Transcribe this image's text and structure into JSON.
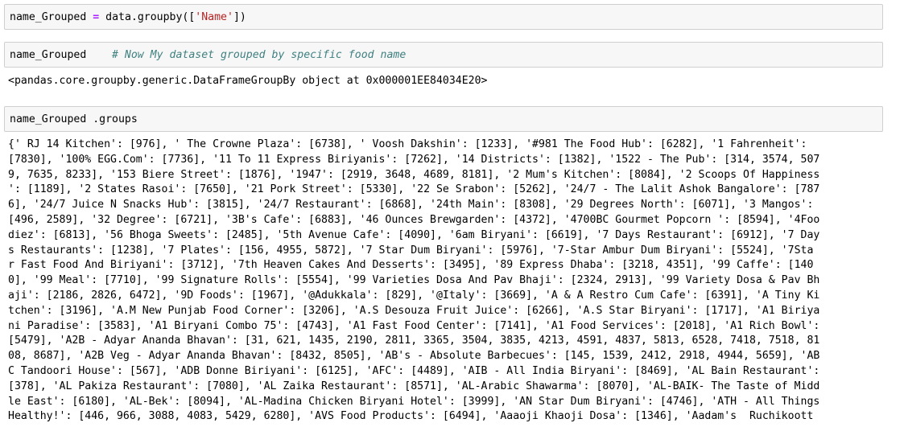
{
  "cells": [
    {
      "code": {
        "var": "name_Grouped",
        "op": "=",
        "rest_pre": "data.groupby([",
        "str": "'Name'",
        "rest_post": "])"
      }
    },
    {
      "code": {
        "var": "name_Grouped",
        "comment": "# Now My dataset grouped by specific food name"
      },
      "output": "<pandas.core.groupby.generic.DataFrameGroupBy object at 0x000001EE84034E20>"
    },
    {
      "code": {
        "var": "name_Grouped .groups"
      },
      "output_lines": [
        "{' RJ 14 Kitchen': [976], ' The Crowne Plaza': [6738], ' Voosh Dakshin': [1233], '#981 The Food Hub': [6282], '1 Fahrenheit':",
        "[7830], '100% EGG.Com': [7736], '11 To 11 Express Biriyanis': [7262], '14 Districts': [1382], '1522 - The Pub': [314, 3574, 507",
        "9, 7635, 8233], '153 Biere Street': [1876], '1947': [2919, 3648, 4689, 8181], '2 Mum's Kitchen': [8084], '2 Scoops Of Happiness",
        "': [1189], '2 States Rasoi': [7650], '21 Pork Street': [5330], '22 Se Srabon': [5262], '24/7 - The Lalit Ashok Bangalore': [787",
        "6], '24/7 Juice N Snacks Hub': [3815], '24/7 Restaurant': [6868], '24th Main': [8308], '29 Degrees North': [6071], '3 Mangos':",
        "[496, 2589], '32 Degree': [6721], '3B's Cafe': [6883], '46 Ounces Brewgarden': [4372], '4700BC Gourmet Popcorn ': [8594], '4Foo",
        "diez': [6813], '56 Bhoga Sweets': [2485], '5th Avenue Cafe': [4090], '6am Biryani': [6619], '7 Days Restaurant': [6912], '7 Day",
        "s Restaurants': [1238], '7 Plates': [156, 4955, 5872], '7 Star Dum Biryani': [5976], '7-Star Ambur Dum Biryani': [5524], '7Sta",
        "r Fast Food And Biriyani': [3712], '7th Heaven Cakes And Desserts': [3495], '89 Express Dhaba': [3218, 4351], '99 Caffe': [140",
        "0], '99 Meal': [7710], '99 Signature Rolls': [5554], '99 Varieties Dosa And Pav Bhaji': [2324, 2913], '99 Variety Dosa & Pav Bh",
        "aji': [2186, 2826, 6472], '9D Foods': [1967], '@Adukkala': [829], '@Italy': [3669], 'A & A Restro Cum Cafe': [6391], 'A Tiny Ki",
        "tchen': [3196], 'A.M New Punjab Food Corner': [3206], 'A.S Desouza Fruit Juice': [6266], 'A.S Star Biryani': [1717], 'A1 Biriya",
        "ni Paradise': [3583], 'A1 Biryani Combo 75': [4743], 'A1 Fast Food Center': [7141], 'A1 Food Services': [2018], 'A1 Rich Bowl':",
        "[5479], 'A2B - Adyar Ananda Bhavan': [31, 621, 1435, 2190, 2811, 3365, 3504, 3835, 4213, 4591, 4837, 5813, 6528, 7418, 7518, 81",
        "08, 8687], 'A2B Veg - Adyar Ananda Bhavan': [8432, 8505], 'AB's - Absolute Barbecues': [145, 1539, 2412, 2918, 4944, 5659], 'AB",
        "C Tandoori House': [567], 'ADB Donne Biriyani': [6125], 'AFC': [4489], 'AIB - All India Biryani': [8469], 'AL Bain Restaurant':",
        "[378], 'AL Pakiza Restaurant': [7080], 'AL Zaika Restaurant': [8571], 'AL-Arabic Shawarma': [8070], 'AL-BAIK- The Taste of Midd",
        "le East': [6180], 'AL-Bek': [8094], 'AL-Madina Chicken Biryani Hotel': [3999], 'AN Star Dum Biryani': [4746], 'ATH - All Things",
        "Healthy!': [446, 966, 3088, 4083, 5429, 6280], 'AVS Food Products': [6494], 'Aaaoji Khaoji Dosa': [1346], 'Aadam's  Ruchikoott"
      ]
    }
  ]
}
